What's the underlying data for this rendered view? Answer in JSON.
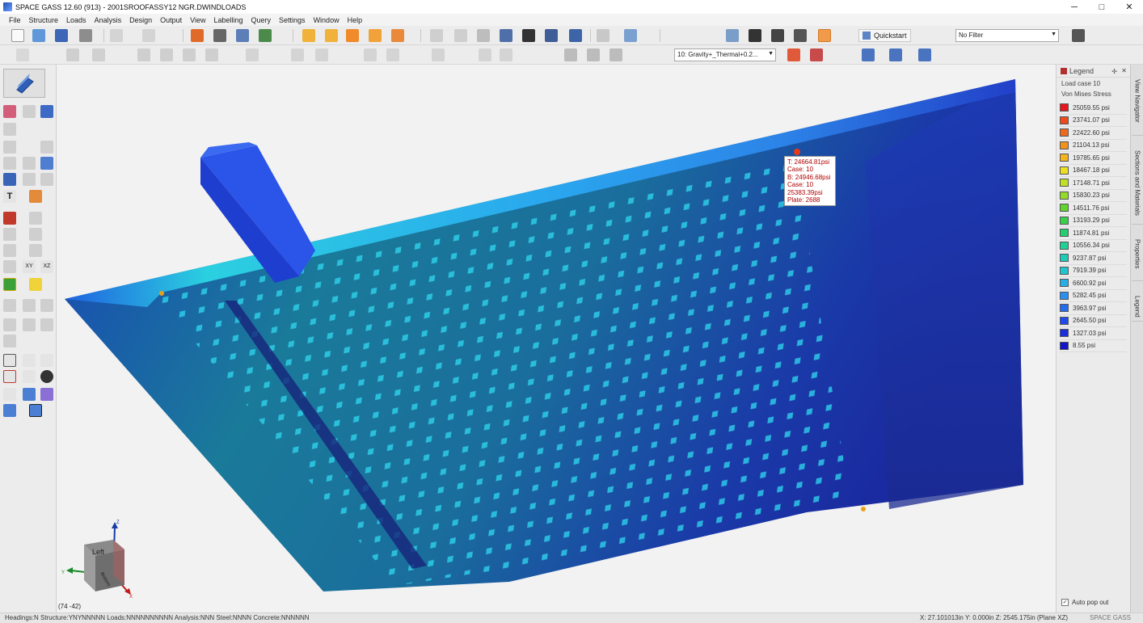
{
  "window": {
    "title": "SPACE GASS 12.60 (913) - 2001SROOFASSY12 NGR.DWINDLOADS",
    "minimize": "─",
    "maximize": "□",
    "close": "✕"
  },
  "menu": [
    "File",
    "Structure",
    "Loads",
    "Analysis",
    "Design",
    "Output",
    "View",
    "Labelling",
    "Query",
    "Settings",
    "Window",
    "Help"
  ],
  "toolbar": {
    "quickstart_label": "Quickstart",
    "filter_value": "No Filter",
    "loadcase_value": "10: Gravity+_Thermal+0.2..."
  },
  "viewport": {
    "coords_label": "(74 -42)",
    "cube_face_front": "Left",
    "cube_face_side": "Bottom",
    "axis_z": "Z",
    "axis_y": "Y",
    "axis_x": "X"
  },
  "tooltip": {
    "lines": [
      "T: 24664.81psi",
      "Case: 10",
      "B: 24946.68psi",
      "Case: 10",
      "25383.39psi",
      "Plate: 2688"
    ]
  },
  "legend": {
    "title": "Legend",
    "load_case": "Load case 10",
    "metric": "Von Mises Stress",
    "auto_popout_label": "Auto pop out",
    "auto_popout_checked": "✓",
    "entries": [
      {
        "value": "25059.55 psi",
        "color": "#e8161b"
      },
      {
        "value": "23741.07 psi",
        "color": "#ef4a1c"
      },
      {
        "value": "22422.60 psi",
        "color": "#f06a1c"
      },
      {
        "value": "21104.13 psi",
        "color": "#f2911c"
      },
      {
        "value": "19785.65 psi",
        "color": "#f3b41e"
      },
      {
        "value": "18467.18 psi",
        "color": "#ece020"
      },
      {
        "value": "17148.71 psi",
        "color": "#bfe123"
      },
      {
        "value": "15830.23 psi",
        "color": "#92dc26"
      },
      {
        "value": "14511.76 psi",
        "color": "#5fd52e"
      },
      {
        "value": "13193.29 psi",
        "color": "#38d04a"
      },
      {
        "value": "11874.81 psi",
        "color": "#22d070"
      },
      {
        "value": "10556.34 psi",
        "color": "#1fd097"
      },
      {
        "value": "9237.87 psi",
        "color": "#1ccdb6"
      },
      {
        "value": "7919.39 psi",
        "color": "#1fc6d2"
      },
      {
        "value": "6600.92 psi",
        "color": "#27aee6"
      },
      {
        "value": "5282.45 psi",
        "color": "#2a8ff0"
      },
      {
        "value": "3963.97 psi",
        "color": "#256bf0"
      },
      {
        "value": "2645.50 psi",
        "color": "#1f49ec"
      },
      {
        "value": "1327.03 psi",
        "color": "#1a2ee0"
      },
      {
        "value": "8.55 psi",
        "color": "#1414c8"
      }
    ]
  },
  "side_tabs": [
    "View Navigator",
    "Sections and Materials",
    "Properties",
    "Legend"
  ],
  "status": {
    "left": "Headings:N Structure:YNYNNNNN Loads:NNNNNNNNNN Analysis:NNN Steel:NNNN Concrete:NNNNNN",
    "right": "X: 27.101013in  Y: 0.000in  Z: 2545.175in  (Plane XZ)",
    "brand": "SPACE GASS"
  }
}
